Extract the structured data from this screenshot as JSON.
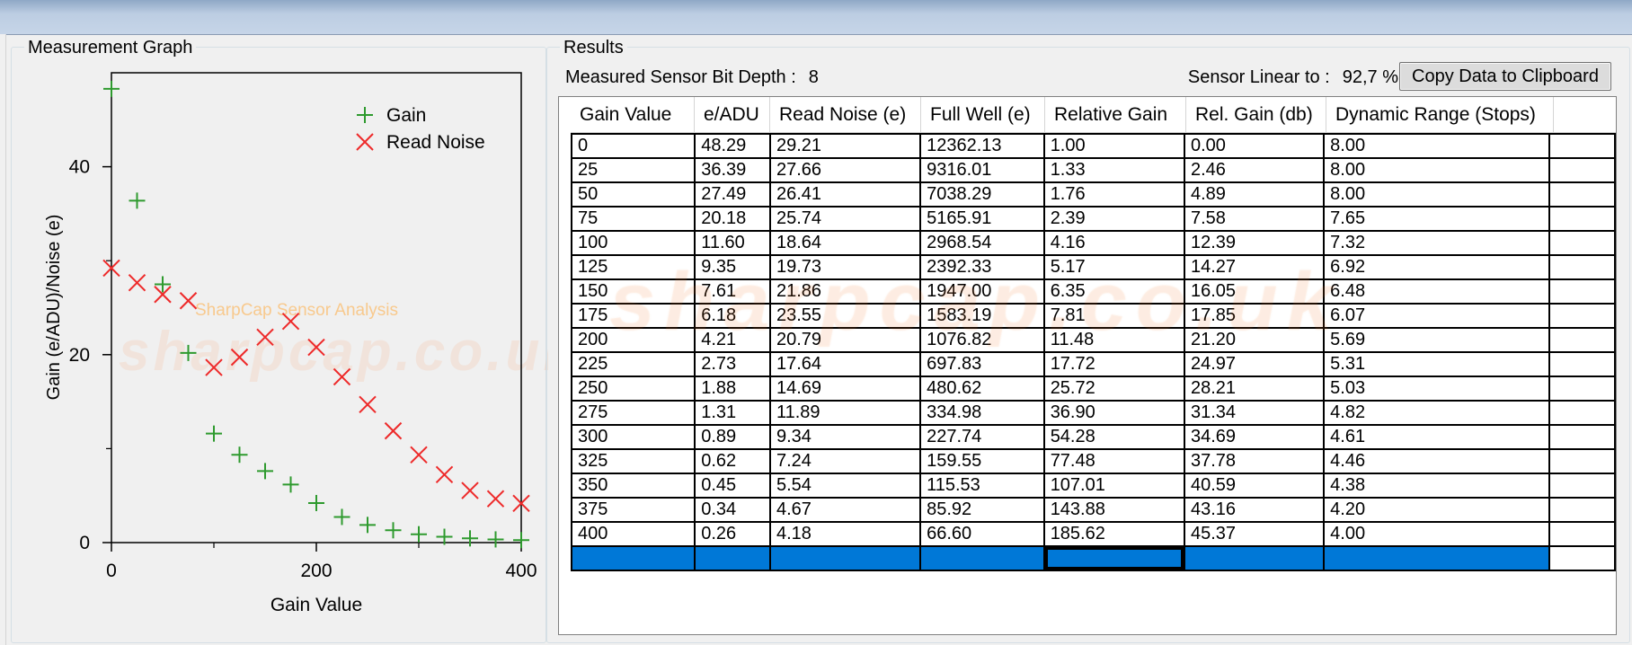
{
  "graph": {
    "group_title": "Measurement Graph",
    "watermark": "sharpcap.co.uk",
    "overlay_label": "SharpCap Sensor Analysis"
  },
  "results": {
    "group_title": "Results",
    "bit_depth_label": "Measured Sensor Bit Depth :",
    "bit_depth_value": "8",
    "linear_label": "Sensor Linear to :",
    "linear_value": "92,7 %",
    "copy_button": "Copy Data to Clipboard",
    "watermark": "sharpcap.co.uk"
  },
  "table": {
    "columns": [
      "Gain Value",
      "e/ADU",
      "Read Noise (e)",
      "Full Well (e)",
      "Relative Gain",
      "Rel. Gain (db)",
      "Dynamic Range (Stops)"
    ],
    "rows": [
      [
        "0",
        "48.29",
        "29.21",
        "12362.13",
        "1.00",
        "0.00",
        "8.00"
      ],
      [
        "25",
        "36.39",
        "27.66",
        "9316.01",
        "1.33",
        "2.46",
        "8.00"
      ],
      [
        "50",
        "27.49",
        "26.41",
        "7038.29",
        "1.76",
        "4.89",
        "8.00"
      ],
      [
        "75",
        "20.18",
        "25.74",
        "5165.91",
        "2.39",
        "7.58",
        "7.65"
      ],
      [
        "100",
        "11.60",
        "18.64",
        "2968.54",
        "4.16",
        "12.39",
        "7.32"
      ],
      [
        "125",
        "9.35",
        "19.73",
        "2392.33",
        "5.17",
        "14.27",
        "6.92"
      ],
      [
        "150",
        "7.61",
        "21.86",
        "1947.00",
        "6.35",
        "16.05",
        "6.48"
      ],
      [
        "175",
        "6.18",
        "23.55",
        "1583.19",
        "7.81",
        "17.85",
        "6.07"
      ],
      [
        "200",
        "4.21",
        "20.79",
        "1076.82",
        "11.48",
        "21.20",
        "5.69"
      ],
      [
        "225",
        "2.73",
        "17.64",
        "697.83",
        "17.72",
        "24.97",
        "5.31"
      ],
      [
        "250",
        "1.88",
        "14.69",
        "480.62",
        "25.72",
        "28.21",
        "5.03"
      ],
      [
        "275",
        "1.31",
        "11.89",
        "334.98",
        "36.90",
        "31.34",
        "4.82"
      ],
      [
        "300",
        "0.89",
        "9.34",
        "227.74",
        "54.28",
        "34.69",
        "4.61"
      ],
      [
        "325",
        "0.62",
        "7.24",
        "159.55",
        "77.48",
        "37.78",
        "4.46"
      ],
      [
        "350",
        "0.45",
        "5.54",
        "115.53",
        "107.01",
        "40.59",
        "4.38"
      ],
      [
        "375",
        "0.34",
        "4.67",
        "85.92",
        "143.88",
        "43.16",
        "4.20"
      ],
      [
        "400",
        "0.26",
        "4.18",
        "66.60",
        "185.62",
        "45.37",
        "4.00"
      ]
    ],
    "new_row_color": "#0078d7"
  },
  "chart_data": {
    "type": "scatter",
    "xlabel": "Gain Value",
    "ylabel": "Gain (e/ADU)/Noise (e)",
    "xlim": [
      0,
      400
    ],
    "ylim": [
      0,
      50
    ],
    "x_ticks": [
      "0",
      "200",
      "400"
    ],
    "y_ticks": [
      "0",
      "20",
      "40"
    ],
    "x_tick_values": [
      0,
      200,
      400
    ],
    "y_tick_values": [
      0,
      20,
      40
    ],
    "x_minor_ticks": [
      100,
      300
    ],
    "y_minor_ticks": [
      10,
      30
    ],
    "grid": false,
    "legend_position": "top-right",
    "x": [
      0,
      25,
      50,
      75,
      100,
      125,
      150,
      175,
      200,
      225,
      250,
      275,
      300,
      325,
      350,
      375,
      400
    ],
    "series": [
      {
        "name": "Gain",
        "marker": "plus",
        "color": "#2e9a2e",
        "values": [
          48.29,
          36.39,
          27.49,
          20.18,
          11.6,
          9.35,
          7.61,
          6.18,
          4.21,
          2.73,
          1.88,
          1.31,
          0.89,
          0.62,
          0.45,
          0.34,
          0.26
        ]
      },
      {
        "name": "Read Noise",
        "marker": "cross",
        "color": "#ee2a2a",
        "values": [
          29.21,
          27.66,
          26.41,
          25.74,
          18.64,
          19.73,
          21.86,
          23.55,
          20.79,
          17.64,
          14.69,
          11.89,
          9.34,
          7.24,
          5.54,
          4.67,
          4.18
        ]
      }
    ]
  }
}
